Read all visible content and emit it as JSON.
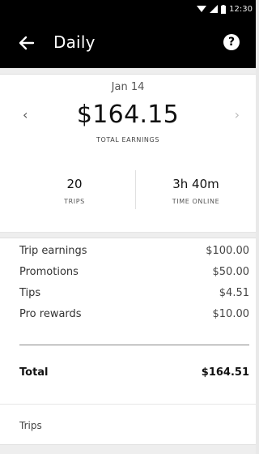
{
  "status_bar": {
    "time": "12:30",
    "icons": [
      "wifi-icon",
      "signal-icon",
      "battery-icon"
    ]
  },
  "app_bar": {
    "title": "Daily",
    "back_icon": "arrow-left-icon",
    "help_icon": "help-icon",
    "help_glyph": "?"
  },
  "summary": {
    "date": "Jan 14",
    "prev_glyph": "‹",
    "next_glyph": "›",
    "total": "$164.15",
    "total_label": "TOTAL EARNINGS",
    "trips_value": "20",
    "trips_label": "TRIPS",
    "time_online_value": "3h 40m",
    "time_online_label": "TIME ONLINE"
  },
  "breakdown": {
    "rows": [
      {
        "label": "Trip earnings",
        "amount": "$100.00"
      },
      {
        "label": "Promotions",
        "amount": "$50.00"
      },
      {
        "label": "Tips",
        "amount": "$4.51"
      },
      {
        "label": "Pro rewards",
        "amount": "$10.00"
      }
    ],
    "total_label": "Total",
    "total_amount": "$164.51",
    "trips_link": "Trips"
  },
  "colors": {
    "header_bg": "#000000",
    "page_bg": "#f7f7f7",
    "card_bg": "#ffffff"
  }
}
